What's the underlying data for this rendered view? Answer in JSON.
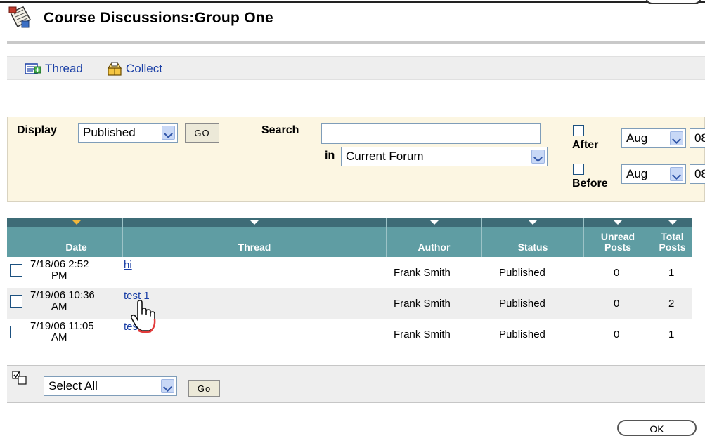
{
  "page": {
    "title": "Course Discussions:Group One"
  },
  "actions": {
    "thread_label": "Thread",
    "collect_label": "Collect"
  },
  "filter": {
    "display_label": "Display",
    "display_value": "Published",
    "go_label": "GO",
    "search_label": "Search",
    "search_value": "",
    "in_label": "in",
    "scope_value": "Current Forum",
    "after_label": "After",
    "before_label": "Before",
    "after_month": "Aug",
    "before_month": "Aug",
    "after_day_partial": "08",
    "before_day_partial": "08"
  },
  "table": {
    "columns": [
      "Date",
      "Thread",
      "Author",
      "Status",
      "Unread Posts",
      "Total Posts"
    ],
    "header_unread_line1": "Unread",
    "header_unread_line2": "Posts",
    "header_total_line1": "Total",
    "header_total_line2": "Posts",
    "rows": [
      {
        "date_line1": "7/18/06 2:52",
        "date_line2": "PM",
        "thread": "hi",
        "author": "Frank Smith",
        "status": "Published",
        "unread": "0",
        "total": "1"
      },
      {
        "date_line1": "7/19/06 10:36",
        "date_line2": "AM",
        "thread": "test 1",
        "author": "Frank Smith",
        "status": "Published",
        "unread": "0",
        "total": "2"
      },
      {
        "date_line1": "7/19/06 11:05",
        "date_line2": "AM",
        "thread": "test 2",
        "author": "Frank Smith",
        "status": "Published",
        "unread": "0",
        "total": "1"
      }
    ]
  },
  "bulk": {
    "select_value": "Select All",
    "go_label": "Go"
  },
  "footer": {
    "ok_label": "OK"
  },
  "colors": {
    "header_teal": "#5f9da3",
    "header_dark": "#3e6c77",
    "filter_bg": "#fcf6e2",
    "link_blue": "#1a3fa6",
    "sort_active": "#f2b63b"
  }
}
